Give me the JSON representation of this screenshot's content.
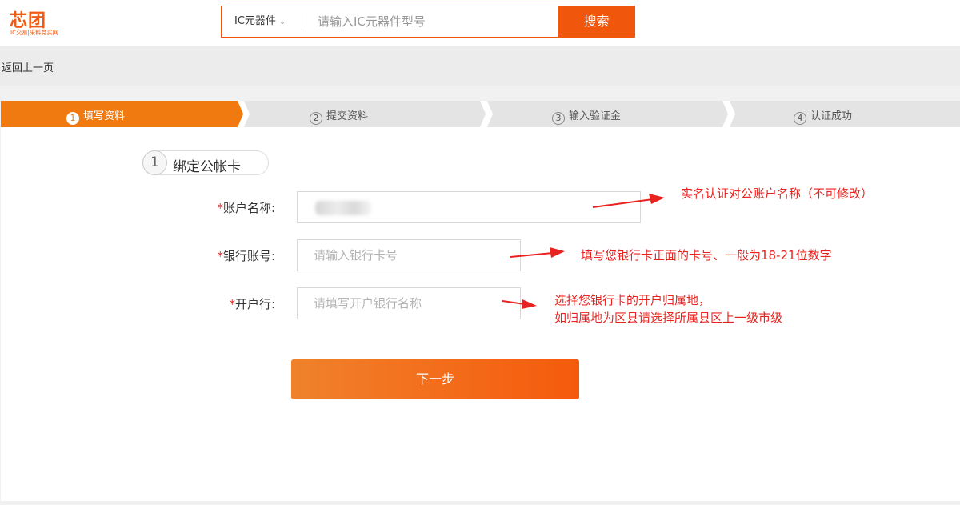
{
  "header": {
    "logo_text": "芯团",
    "logo_slogan": "IC交易|采料竞买网",
    "search": {
      "category": "IC元器件",
      "placeholder": "请输入IC元器件型号",
      "button_label": "搜索"
    }
  },
  "back_label": "返回上一页",
  "steps": [
    {
      "num": "1",
      "label": "填写资料",
      "active": true
    },
    {
      "num": "2",
      "label": "提交资料",
      "active": false
    },
    {
      "num": "3",
      "label": "输入验证金",
      "active": false
    },
    {
      "num": "4",
      "label": "认证成功",
      "active": false
    }
  ],
  "section": {
    "num": "1",
    "title": "绑定公帐卡"
  },
  "form": {
    "account_name": {
      "required_mark": "*",
      "label": "账户名称:"
    },
    "bank_account": {
      "required_mark": "*",
      "label": "银行账号:",
      "placeholder": "请输入银行卡号"
    },
    "bank_branch": {
      "required_mark": "*",
      "label": "开户行:",
      "placeholder": "请填写开户银行名称"
    },
    "next_label": "下一步"
  },
  "annotations": {
    "account_name_note": "实名认证对公账户名称（不可修改）",
    "bank_account_note": "填写您银行卡正面的卡号、一般为18-21位数字",
    "bank_branch_note_line1": "选择您银行卡的开户归属地，",
    "bank_branch_note_line2": "如归属地为区县请选择所属县区上一级市级"
  },
  "colors": {
    "brand_orange": "#f0560c",
    "step_active": "#f07a10",
    "step_inactive": "#e4e4e4",
    "annotation_red": "#e8231f"
  }
}
